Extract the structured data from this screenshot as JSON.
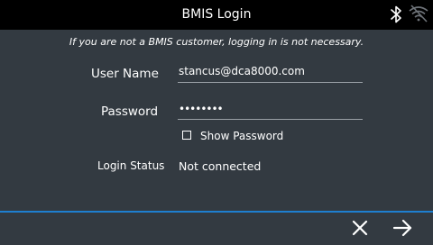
{
  "header": {
    "title": "BMIS Login",
    "icons": [
      "bluetooth-icon",
      "wifi-disabled-icon"
    ]
  },
  "notice": "If you are not a BMIS customer, logging in is not necessary.",
  "form": {
    "username_label": "User Name",
    "username_value": "stancus@dca8000.com",
    "password_label": "Password",
    "password_value": "••••••••",
    "show_password_label": "Show Password",
    "show_password_checked": false,
    "status_label": "Login Status",
    "status_value": "Not connected"
  },
  "footer": {
    "cancel_icon": "close-icon",
    "next_icon": "arrow-right-icon",
    "accent_color": "#1e7fd0"
  }
}
